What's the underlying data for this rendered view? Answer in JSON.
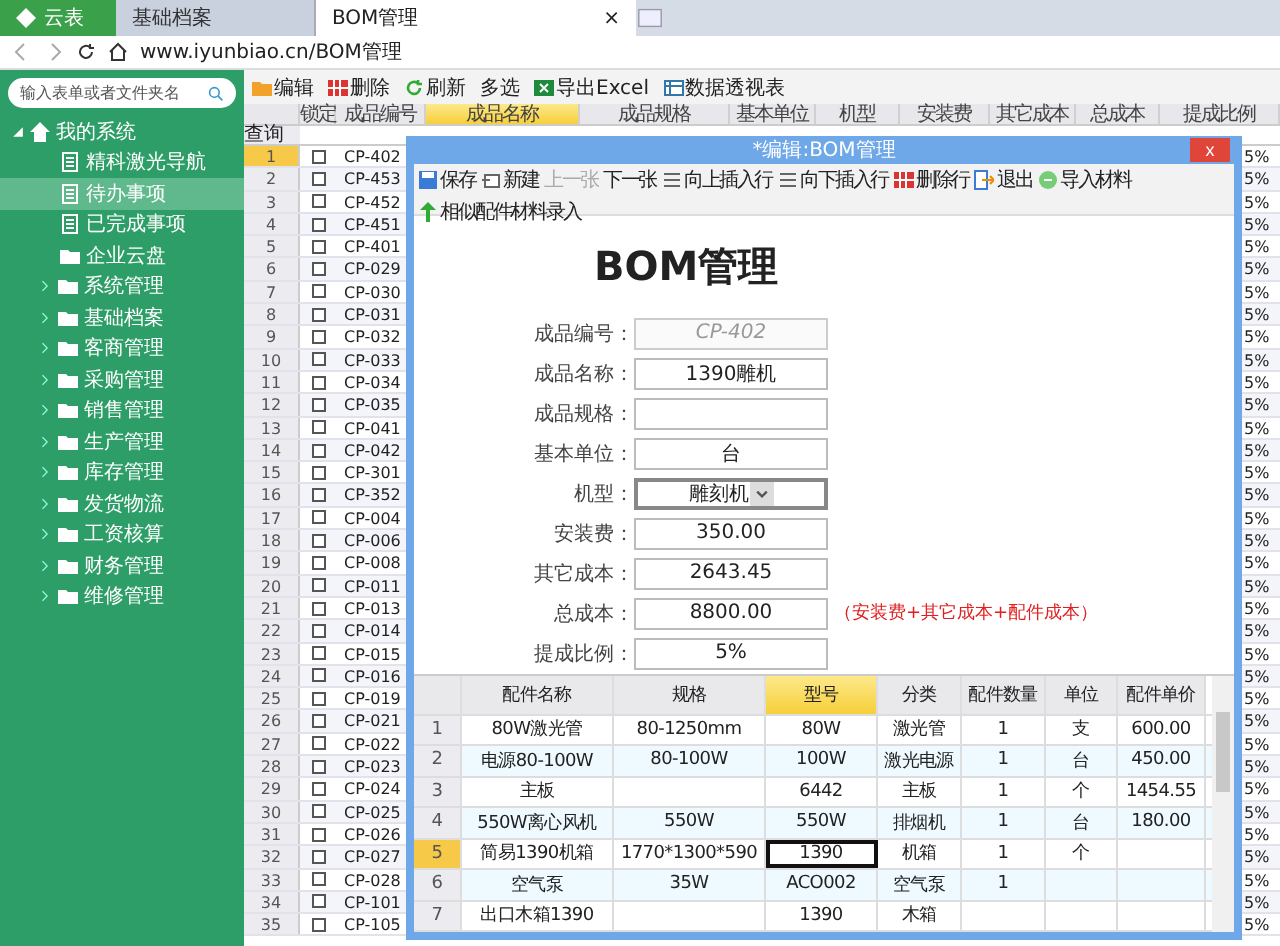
{
  "browser": {
    "brand": {
      "label": "云表"
    },
    "tabs": [
      {
        "label": "基础档案",
        "selected": false
      },
      {
        "label": "BOM管理",
        "selected": true,
        "close": "×"
      }
    ],
    "url": "www.iyunbiao.cn/BOM管理"
  },
  "sidebar": {
    "search": {
      "placeholder": "输入表单或者文件夹名"
    },
    "root": {
      "label": "我的系统",
      "expanded": true,
      "children": [
        {
          "label": "精科激光导航",
          "kind": "page",
          "selected": false
        },
        {
          "label": "待办事项",
          "kind": "page",
          "selected": true
        },
        {
          "label": "已完成事项",
          "kind": "page",
          "selected": false
        },
        {
          "label": "企业云盘",
          "kind": "folder",
          "selected": false
        },
        {
          "label": "系统管理",
          "kind": "group",
          "selected": false
        },
        {
          "label": "基础档案",
          "kind": "group",
          "selected": false
        },
        {
          "label": "客商管理",
          "kind": "group",
          "selected": false
        },
        {
          "label": "采购管理",
          "kind": "group",
          "selected": false
        },
        {
          "label": "销售管理",
          "kind": "group",
          "selected": false
        },
        {
          "label": "生产管理",
          "kind": "group",
          "selected": false
        },
        {
          "label": "库存管理",
          "kind": "group",
          "selected": false
        },
        {
          "label": "发货物流",
          "kind": "group",
          "selected": false
        },
        {
          "label": "工资核算",
          "kind": "group",
          "selected": false
        },
        {
          "label": "财务管理",
          "kind": "group",
          "selected": false
        },
        {
          "label": "维修管理",
          "kind": "group",
          "selected": false
        }
      ]
    }
  },
  "toolbar": [
    {
      "label": "编辑",
      "kind": "edit"
    },
    {
      "label": "删除",
      "kind": "delete"
    },
    {
      "label": "刷新",
      "kind": "refresh"
    },
    {
      "label": "多选",
      "kind": "text"
    },
    {
      "label": "导出Excel",
      "kind": "excel"
    },
    {
      "label": "数据透视表",
      "kind": "pivot"
    }
  ],
  "table": {
    "columns": [
      {
        "label": "锁定",
        "selected": false
      },
      {
        "label": "成品编号",
        "selected": false
      },
      {
        "label": "成品名称",
        "selected": true
      },
      {
        "label": "成品规格",
        "selected": false
      },
      {
        "label": "基本单位",
        "selected": false
      },
      {
        "label": "机型",
        "selected": false
      },
      {
        "label": "安装费",
        "selected": false
      },
      {
        "label": "其它成本",
        "selected": false
      },
      {
        "label": "总成本",
        "selected": false
      },
      {
        "label": "提成比例",
        "selected": false
      }
    ],
    "query_label": "查询",
    "rows": [
      {
        "n": "1",
        "code": "CP-402",
        "ratio": "5%",
        "locked": false,
        "selected": true
      },
      {
        "n": "2",
        "code": "CP-453",
        "ratio": "5%",
        "locked": false,
        "selected": false
      },
      {
        "n": "3",
        "code": "CP-452",
        "ratio": "5%",
        "locked": false,
        "selected": false
      },
      {
        "n": "4",
        "code": "CP-451",
        "ratio": "5%",
        "locked": false,
        "selected": false
      },
      {
        "n": "5",
        "code": "CP-401",
        "ratio": "5%",
        "locked": false,
        "selected": false
      },
      {
        "n": "6",
        "code": "CP-029",
        "ratio": "5%",
        "locked": false,
        "selected": false
      },
      {
        "n": "7",
        "code": "CP-030",
        "ratio": "5%",
        "locked": false,
        "selected": false
      },
      {
        "n": "8",
        "code": "CP-031",
        "ratio": "5%",
        "locked": false,
        "selected": false
      },
      {
        "n": "9",
        "code": "CP-032",
        "ratio": "5%",
        "locked": false,
        "selected": false
      },
      {
        "n": "10",
        "code": "CP-033",
        "ratio": "5%",
        "locked": false,
        "selected": false
      },
      {
        "n": "11",
        "code": "CP-034",
        "ratio": "5%",
        "locked": false,
        "selected": false
      },
      {
        "n": "12",
        "code": "CP-035",
        "ratio": "5%",
        "locked": false,
        "selected": false
      },
      {
        "n": "13",
        "code": "CP-041",
        "ratio": "5%",
        "locked": false,
        "selected": false
      },
      {
        "n": "14",
        "code": "CP-042",
        "ratio": "5%",
        "locked": false,
        "selected": false
      },
      {
        "n": "15",
        "code": "CP-301",
        "ratio": "5%",
        "locked": false,
        "selected": false
      },
      {
        "n": "16",
        "code": "CP-352",
        "ratio": "5%",
        "locked": false,
        "selected": false
      },
      {
        "n": "17",
        "code": "CP-004",
        "ratio": "5%",
        "locked": false,
        "selected": false
      },
      {
        "n": "18",
        "code": "CP-006",
        "ratio": "5%",
        "locked": false,
        "selected": false
      },
      {
        "n": "19",
        "code": "CP-008",
        "ratio": "5%",
        "locked": false,
        "selected": false
      },
      {
        "n": "20",
        "code": "CP-011",
        "ratio": "5%",
        "locked": false,
        "selected": false
      },
      {
        "n": "21",
        "code": "CP-013",
        "ratio": "5%",
        "locked": false,
        "selected": false
      },
      {
        "n": "22",
        "code": "CP-014",
        "ratio": "5%",
        "locked": false,
        "selected": false
      },
      {
        "n": "23",
        "code": "CP-015",
        "ratio": "5%",
        "locked": false,
        "selected": false
      },
      {
        "n": "24",
        "code": "CP-016",
        "ratio": "5%",
        "locked": false,
        "selected": false
      },
      {
        "n": "25",
        "code": "CP-019",
        "ratio": "5%",
        "locked": false,
        "selected": false
      },
      {
        "n": "26",
        "code": "CP-021",
        "ratio": "5%",
        "locked": false,
        "selected": false
      },
      {
        "n": "27",
        "code": "CP-022",
        "ratio": "5%",
        "locked": false,
        "selected": false
      },
      {
        "n": "28",
        "code": "CP-023",
        "ratio": "5%",
        "locked": false,
        "selected": false
      },
      {
        "n": "29",
        "code": "CP-024",
        "ratio": "5%",
        "locked": false,
        "selected": false
      },
      {
        "n": "30",
        "code": "CP-025",
        "ratio": "5%",
        "locked": false,
        "selected": false
      },
      {
        "n": "31",
        "code": "CP-026",
        "ratio": "5%",
        "locked": false,
        "selected": false
      },
      {
        "n": "32",
        "code": "CP-027",
        "ratio": "5%",
        "locked": false,
        "selected": false
      },
      {
        "n": "33",
        "code": "CP-028",
        "ratio": "5%",
        "locked": false,
        "selected": false
      },
      {
        "n": "34",
        "code": "CP-101",
        "ratio": "5%",
        "locked": false,
        "selected": false
      },
      {
        "n": "35",
        "code": "CP-105",
        "ratio": "5%",
        "locked": false,
        "selected": false
      }
    ]
  },
  "dialog": {
    "title": "*编辑:BOM管理",
    "close": "x",
    "toolbar": [
      {
        "label": "保存",
        "kind": "save",
        "disabled": false
      },
      {
        "label": "新建",
        "kind": "new",
        "disabled": false
      },
      {
        "label": "上一张",
        "kind": "text",
        "disabled": true
      },
      {
        "label": "下一张",
        "kind": "text",
        "disabled": false
      },
      {
        "label": "向上插入行",
        "kind": "insert",
        "disabled": false
      },
      {
        "label": "向下插入行",
        "kind": "insert",
        "disabled": false
      },
      {
        "label": "删除行",
        "kind": "delete",
        "disabled": false
      },
      {
        "label": "退出",
        "kind": "exit",
        "disabled": false
      },
      {
        "label": "导入材料",
        "kind": "import",
        "disabled": false
      },
      {
        "label": "相似配件材料录入",
        "kind": "up",
        "disabled": false
      }
    ],
    "heading": "BOM管理",
    "fields": [
      {
        "label": "成品编号：",
        "kind": "text",
        "value": "CP-402",
        "readonly": true
      },
      {
        "label": "成品名称：",
        "kind": "text",
        "value": "1390雕机",
        "readonly": false
      },
      {
        "label": "成品规格：",
        "kind": "text",
        "readonly": false
      },
      {
        "label": "基本单位：",
        "kind": "text",
        "value": "台",
        "readonly": false
      },
      {
        "label": "机型：",
        "kind": "select",
        "value": "雕刻机",
        "readonly": false
      },
      {
        "label": "安装费：",
        "kind": "text",
        "value": "350.00",
        "readonly": false
      },
      {
        "label": "其它成本：",
        "kind": "text",
        "value": "2643.45",
        "readonly": false
      },
      {
        "label": "总成本：",
        "kind": "text",
        "value": "8800.00",
        "readonly": false,
        "note": "（安装费+其它成本+配件成本）"
      },
      {
        "label": "提成比例：",
        "kind": "text",
        "value": "5%",
        "readonly": false
      }
    ],
    "parts": {
      "columns": [
        {
          "label": "配件名称",
          "selected": false
        },
        {
          "label": "规格",
          "selected": false
        },
        {
          "label": "型号",
          "selected": true
        },
        {
          "label": "分类",
          "selected": false
        },
        {
          "label": "配件数量",
          "selected": false
        },
        {
          "label": "单位",
          "selected": false
        },
        {
          "label": "配件单价",
          "selected": false
        }
      ],
      "rows": [
        {
          "n": "1",
          "selected": false,
          "cells": [
            "80W激光管",
            "80-1250mm",
            "80W",
            "激光管",
            "1",
            "支",
            "600.00"
          ]
        },
        {
          "n": "2",
          "selected": false,
          "cells": [
            "电源80-100W",
            "80-100W",
            "100W",
            "激光电源",
            "1",
            "台",
            "450.00"
          ]
        },
        {
          "n": "3",
          "selected": false,
          "cells": [
            "主板",
            "",
            "6442",
            "主板",
            "1",
            "个",
            "1454.55"
          ]
        },
        {
          "n": "4",
          "selected": false,
          "cells": [
            "550W离心风机",
            "550W",
            "550W",
            "排烟机",
            "1",
            "台",
            "180.00"
          ]
        },
        {
          "n": "5",
          "selected": true,
          "cells": [
            "简易1390机箱",
            "1770*1300*590",
            "1390",
            "机箱",
            "1",
            "个"
          ]
        },
        {
          "n": "6",
          "selected": false,
          "cells": [
            "空气泵",
            "35W",
            "ACO002",
            "空气泵",
            "1"
          ]
        },
        {
          "n": "7",
          "selected": false,
          "cells": [
            "出口木箱1390",
            "",
            "1390",
            "木箱"
          ]
        }
      ]
    }
  }
}
